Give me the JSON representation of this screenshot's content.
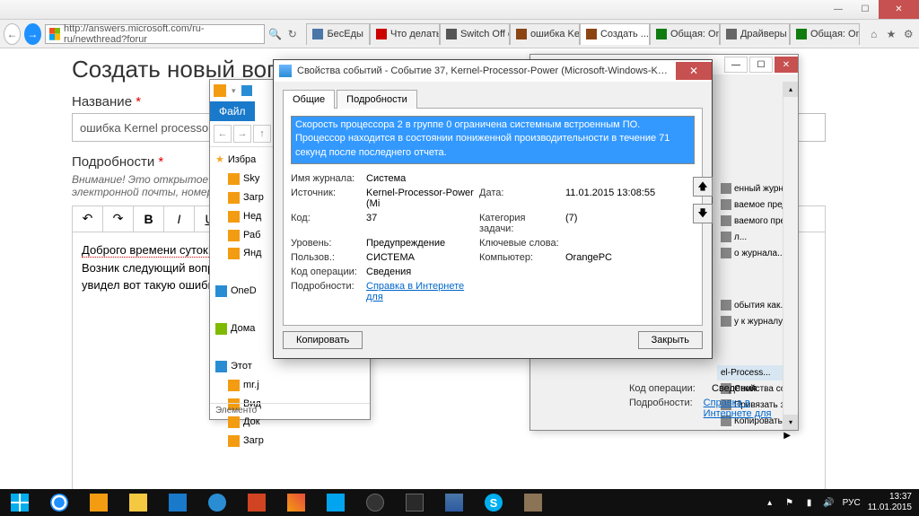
{
  "ie": {
    "url": "http://answers.microsoft.com/ru-ru/newthread?forur",
    "tabs": [
      {
        "label": "БесЕды",
        "fav": "#4a76a8"
      },
      {
        "label": "Что делать ...",
        "fav": "#cc0000"
      },
      {
        "label": "Switch Off с...",
        "fav": "#555"
      },
      {
        "label": "ошибка Ker...",
        "fav": "#8b4513"
      },
      {
        "label": "Создать ...",
        "fav": "#8b4513",
        "active": true,
        "x": true
      },
      {
        "label": "Общая: On...",
        "fav": "#107c10"
      },
      {
        "label": "Драйверы ...",
        "fav": "#666"
      },
      {
        "label": "Общая: On...",
        "fav": "#107c10"
      }
    ]
  },
  "page": {
    "h1": "Создать новый вопрос или начать обсуждение",
    "title_label": "Название",
    "title_value": "ошибка Kernel processor p",
    "details_label": "Подробности",
    "warning": "Внимание! Это открытое оо...\nэлектронной почты, номер",
    "toolbar": [
      "↶",
      "↷",
      "B",
      "I",
      "U"
    ],
    "body_line1": "Доброго времени суток!",
    "body_line2": "Возник следующий вопрос",
    "body_line3": "увидел вот такую ошибку"
  },
  "fm": {
    "tab": "Файл",
    "favorites": "Избра",
    "items": [
      "Sky",
      "Загр",
      "Нед",
      "Раб",
      "Янд"
    ],
    "section2": "OneD",
    "section3": "Дома",
    "section4": "Этот",
    "items4": [
      "mr.j",
      "Вид",
      "Док",
      "Загр"
    ],
    "status": "Элементо"
  },
  "ev": {
    "actions": [
      "енный журна...",
      "ваемое предс...",
      "ваемого пред...",
      "л...",
      "о журнала..."
    ],
    "section2_hdr": "el-Process...",
    "actions2": [
      "обытия как...",
      "у к журналу..."
    ],
    "actions3": [
      "Свойства событий",
      "Привязать задачу к событию...",
      "Копировать"
    ],
    "bot": {
      "op_l": "Код операции:",
      "op_v": "Сведения",
      "det_l": "Подробности:",
      "det_link": "Справка в Интернете для"
    }
  },
  "dlg": {
    "title": "Свойства событий - Событие 37, Kernel-Processor-Power (Microsoft-Windows-Ker...",
    "tabs": [
      "Общие",
      "Подробности"
    ],
    "message": "Скорость процессора 2 в группе 0 ограничена системным встроенным ПО. Процессор находится в состоянии пониженной производительности в течение 71 секунд после последнего отчета.",
    "fields": {
      "log_l": "Имя журнала:",
      "log_v": "Система",
      "src_l": "Источник:",
      "src_v": "Kernel-Processor-Power (Mi",
      "date_l": "Дата:",
      "date_v": "11.01.2015 13:08:55",
      "code_l": "Код:",
      "code_v": "37",
      "cat_l": "Категория задачи:",
      "cat_v": "(7)",
      "lvl_l": "Уровень:",
      "lvl_v": "Предупреждение",
      "kw_l": "Ключевые слова:",
      "kw_v": "",
      "usr_l": "Пользов.:",
      "usr_v": "СИСТЕМА",
      "cmp_l": "Компьютер:",
      "cmp_v": "OrangePC",
      "op_l": "Код операции:",
      "op_v": "Сведения",
      "det_l": "Подробности:",
      "det_link": "Справка в Интернете для"
    },
    "btn_copy": "Копировать",
    "btn_close": "Закрыть"
  },
  "taskbar": {
    "lang": "РУС",
    "time": "13:37",
    "date": "11.01.2015"
  }
}
